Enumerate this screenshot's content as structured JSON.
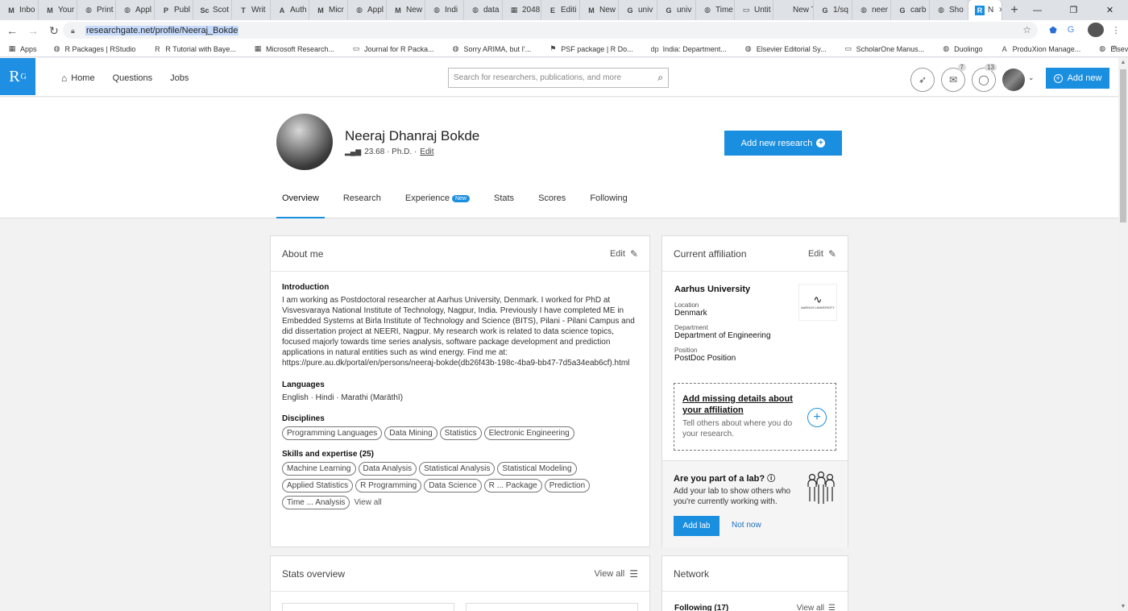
{
  "browser": {
    "tabs": [
      {
        "icon": "M",
        "label": "Inbo"
      },
      {
        "icon": "M",
        "label": "Your"
      },
      {
        "icon": "◍",
        "label": "Print"
      },
      {
        "icon": "◍",
        "label": "Appl"
      },
      {
        "icon": "P",
        "label": "Publ"
      },
      {
        "icon": "Sc",
        "label": "Scot"
      },
      {
        "icon": "T",
        "label": "Writ"
      },
      {
        "icon": "A",
        "label": "Auth"
      },
      {
        "icon": "M",
        "label": "Micr"
      },
      {
        "icon": "◍",
        "label": "Appl"
      },
      {
        "icon": "M",
        "label": "New"
      },
      {
        "icon": "◍",
        "label": "Indi"
      },
      {
        "icon": "◍",
        "label": "data"
      },
      {
        "icon": "▦",
        "label": "2048"
      },
      {
        "icon": "E",
        "label": "Editi"
      },
      {
        "icon": "M",
        "label": "New"
      },
      {
        "icon": "G",
        "label": "univ"
      },
      {
        "icon": "G",
        "label": "univ"
      },
      {
        "icon": "◍",
        "label": "Time"
      },
      {
        "icon": "▭",
        "label": "Untit"
      },
      {
        "icon": "",
        "label": "New Tab"
      },
      {
        "icon": "G",
        "label": "1/sq"
      },
      {
        "icon": "◍",
        "label": "neer"
      },
      {
        "icon": "G",
        "label": "carb"
      },
      {
        "icon": "◍",
        "label": "Sho"
      },
      {
        "icon": "R",
        "label": "N"
      }
    ],
    "new_tab_label": "+",
    "window_controls": [
      "—",
      "❐",
      "✕"
    ],
    "url": "researchgate.net/profile/Neeraj_Bokde",
    "bookmarks": [
      {
        "icon": "▦",
        "label": "Apps"
      },
      {
        "icon": "◍",
        "label": "R Packages | RStudio"
      },
      {
        "icon": "R",
        "label": "R Tutorial with Baye..."
      },
      {
        "icon": "▦",
        "label": "Microsoft Research..."
      },
      {
        "icon": "▭",
        "label": "Journal for R Packa..."
      },
      {
        "icon": "◍",
        "label": "Sorry ARIMA, but I'..."
      },
      {
        "icon": "⚑",
        "label": "PSF package | R Do..."
      },
      {
        "icon": "dp",
        "label": "India: Department..."
      },
      {
        "icon": "◍",
        "label": "Elsevier Editorial Sy..."
      },
      {
        "icon": "▭",
        "label": "ScholarOne Manus..."
      },
      {
        "icon": "◍",
        "label": "Duolingo"
      },
      {
        "icon": "A",
        "label": "ProduXion Manage..."
      },
      {
        "icon": "◍",
        "label": "Elsevier Journal Me..."
      }
    ]
  },
  "rg": {
    "logo": "R",
    "logo_sup": "G",
    "nav": [
      "Home",
      "Questions",
      "Jobs"
    ],
    "search_placeholder": "Search for researchers, publications, and more",
    "messages_count": "7",
    "notifications_count": "13",
    "add_new": "Add new"
  },
  "profile": {
    "name": "Neeraj Dhanraj Bokde",
    "score": "23.68",
    "degree": "· Ph.D. ·",
    "edit": "Edit",
    "add_research": "Add new research",
    "tabs": [
      "Overview",
      "Research",
      "Experience",
      "Stats",
      "Scores",
      "Following"
    ],
    "new_badge": "New"
  },
  "about": {
    "title": "About me",
    "edit": "Edit",
    "intro_title": "Introduction",
    "intro_text": "I am working as Postdoctoral researcher at Aarhus University, Denmark. I worked for PhD at Visvesvaraya National Institute of Technology, Nagpur, India. Previously I have completed ME in Embedded Systems at Birla Institute of Technology and Science (BITS), Pilani - Pilani Campus and did dissertation project at NEERI, Nagpur. My research work is related to data science topics, focused majorly towards time series analysis, software package development and prediction applications in natural entities such as wind energy. Find me at: https://pure.au.dk/portal/en/persons/neeraj-bokde(db26f43b-198c-4ba9-bb47-7d5a34eab6cf).html",
    "languages_title": "Languages",
    "languages": "English · Hindi · Marathi (Marāthī)",
    "disciplines_title": "Disciplines",
    "disciplines": [
      "Programming Languages",
      "Data Mining",
      "Statistics",
      "Electronic Engineering"
    ],
    "skills_title": "Skills and expertise (25)",
    "skills": [
      "Machine Learning",
      "Data Analysis",
      "Statistical Analysis",
      "Statistical Modeling",
      "Applied Statistics",
      "R Programming",
      "Data Science",
      "R ... Package",
      "Prediction",
      "Time ... Analysis"
    ],
    "view_all": "View all"
  },
  "affiliation": {
    "title": "Current affiliation",
    "edit": "Edit",
    "university": "Aarhus University",
    "logo_text": "AARHUS UNIVERSITY",
    "location_label": "Location",
    "location": "Denmark",
    "department_label": "Department",
    "department": "Department of Engineering",
    "position_label": "Position",
    "position": "PostDoc Position",
    "missing_title": "Add missing details about your affiliation",
    "missing_sub": "Tell others about where you do your research.",
    "lab_title": "Are you part of a lab?",
    "lab_sub": "Add your lab to show others who you're currently working with.",
    "add_lab": "Add lab",
    "not_now": "Not now"
  },
  "stats": {
    "title": "Stats overview",
    "view_all": "View all"
  },
  "network": {
    "title": "Network",
    "following": "Following (17)",
    "view_all": "View all"
  }
}
